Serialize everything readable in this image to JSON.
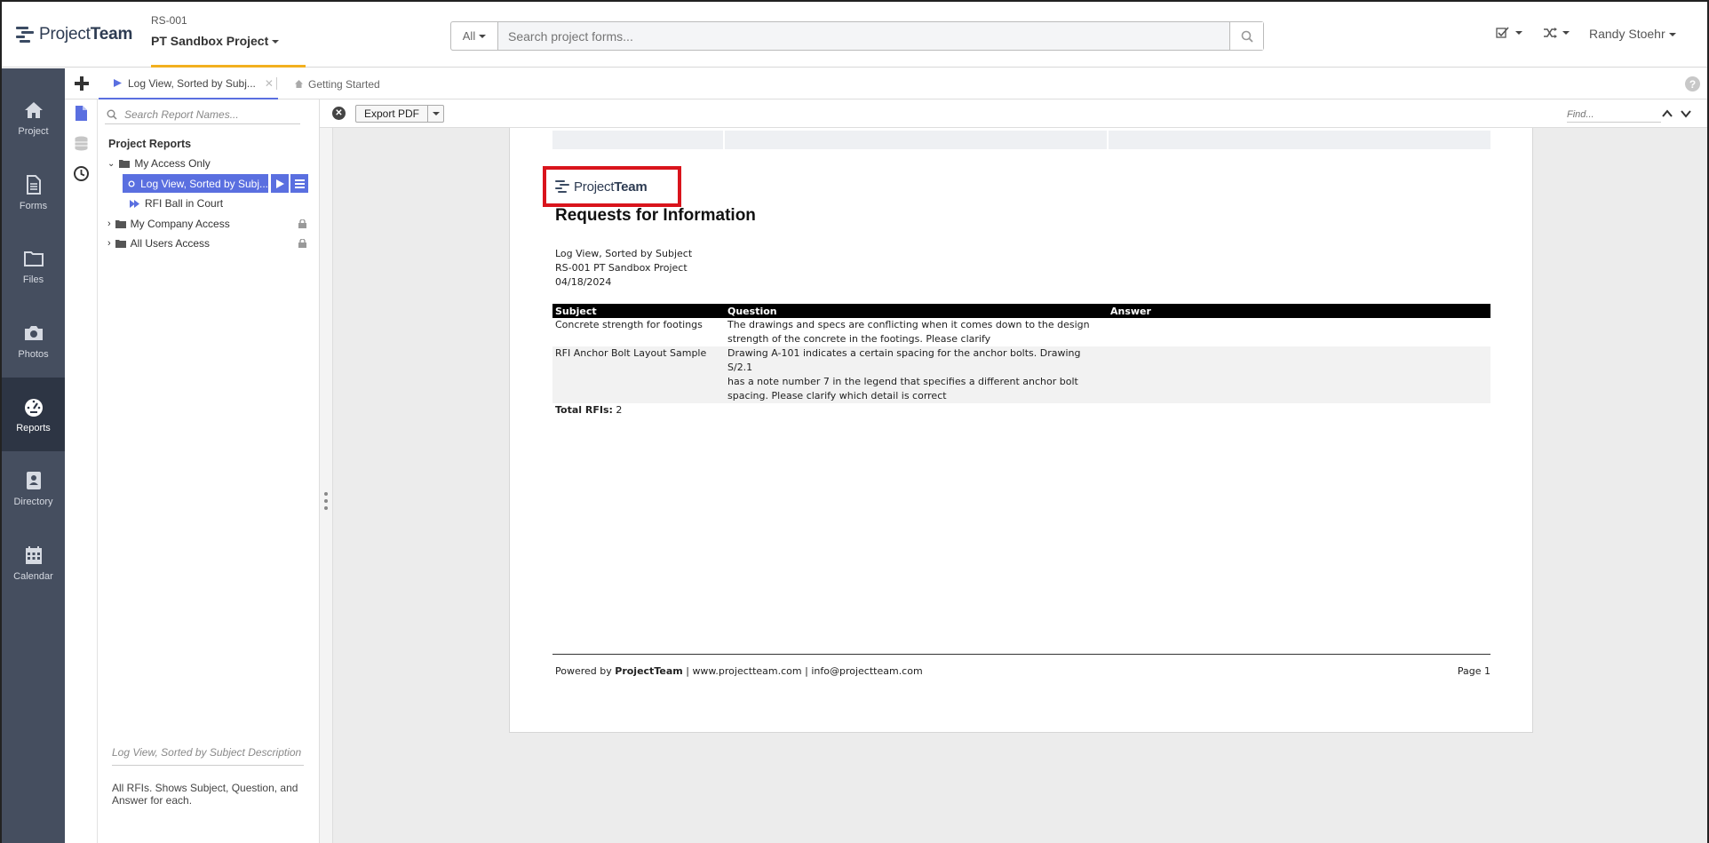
{
  "header": {
    "logo_text_light": "Project",
    "logo_text_bold": "Team",
    "project_id": "RS-001",
    "project_name": "PT Sandbox Project",
    "search_filter": "All",
    "search_placeholder": "Search project forms...",
    "user_name": "Randy Stoehr"
  },
  "leftnav": {
    "items": [
      {
        "label": "Project",
        "icon": "home-icon"
      },
      {
        "label": "Forms",
        "icon": "document-icon"
      },
      {
        "label": "Files",
        "icon": "folder-icon"
      },
      {
        "label": "Photos",
        "icon": "camera-icon"
      },
      {
        "label": "Reports",
        "icon": "gauge-icon",
        "active": true
      },
      {
        "label": "Directory",
        "icon": "contact-book-icon"
      },
      {
        "label": "Calendar",
        "icon": "calendar-icon"
      }
    ]
  },
  "tabs": {
    "active_label": "Log View, Sorted by Subj...",
    "second_label": "Getting Started"
  },
  "tree": {
    "search_placeholder": "Search Report Names...",
    "title": "Project Reports",
    "folder_my_access": "My Access Only",
    "selected_report": "Log View, Sorted by Subj...",
    "report_rfi_ball": "RFI Ball in Court",
    "folder_company": "My Company Access",
    "folder_all_users": "All Users Access",
    "desc_title": "Log View, Sorted by Subject Description",
    "desc_text": "All RFIs. Shows Subject, Question, and Answer for each."
  },
  "toolbar": {
    "export_label": "Export PDF",
    "find_placeholder": "Find..."
  },
  "report": {
    "logo_light": "Project",
    "logo_bold": "Team",
    "title": "Requests for Information",
    "subtitle": "Log View, Sorted by Subject",
    "project": "RS-001 PT Sandbox Project",
    "date": "04/18/2024",
    "columns": [
      "Subject",
      "Question",
      "Answer"
    ],
    "rows": [
      {
        "subject": "Concrete strength for footings",
        "question_lines": [
          "The drawings and specs are conflicting when it comes down to the design",
          "strength of the concrete in the footings. Please clarify"
        ],
        "answer": ""
      },
      {
        "subject": "RFI Anchor Bolt Layout Sample",
        "question_lines": [
          "Drawing A-101 indicates a certain spacing for the anchor bolts. Drawing S/2.1",
          "has a note number 7 in the legend that specifies a different anchor bolt",
          "spacing. Please clarify which detail is correct"
        ],
        "answer": ""
      }
    ],
    "total_label": "Total RFIs:",
    "total_value": "2",
    "footer_powered": "Powered by",
    "footer_brand": "ProjectTeam",
    "footer_sep": "|",
    "footer_url": "www.projectteam.com",
    "footer_email": "info@projectteam.com",
    "footer_page": "Page 1"
  },
  "colors": {
    "nav_bg": "#454e5f",
    "nav_active": "#2d3544",
    "accent": "#5a6fe0",
    "project_underline": "#f2b01e",
    "logo_highlight": "#d9141c"
  }
}
